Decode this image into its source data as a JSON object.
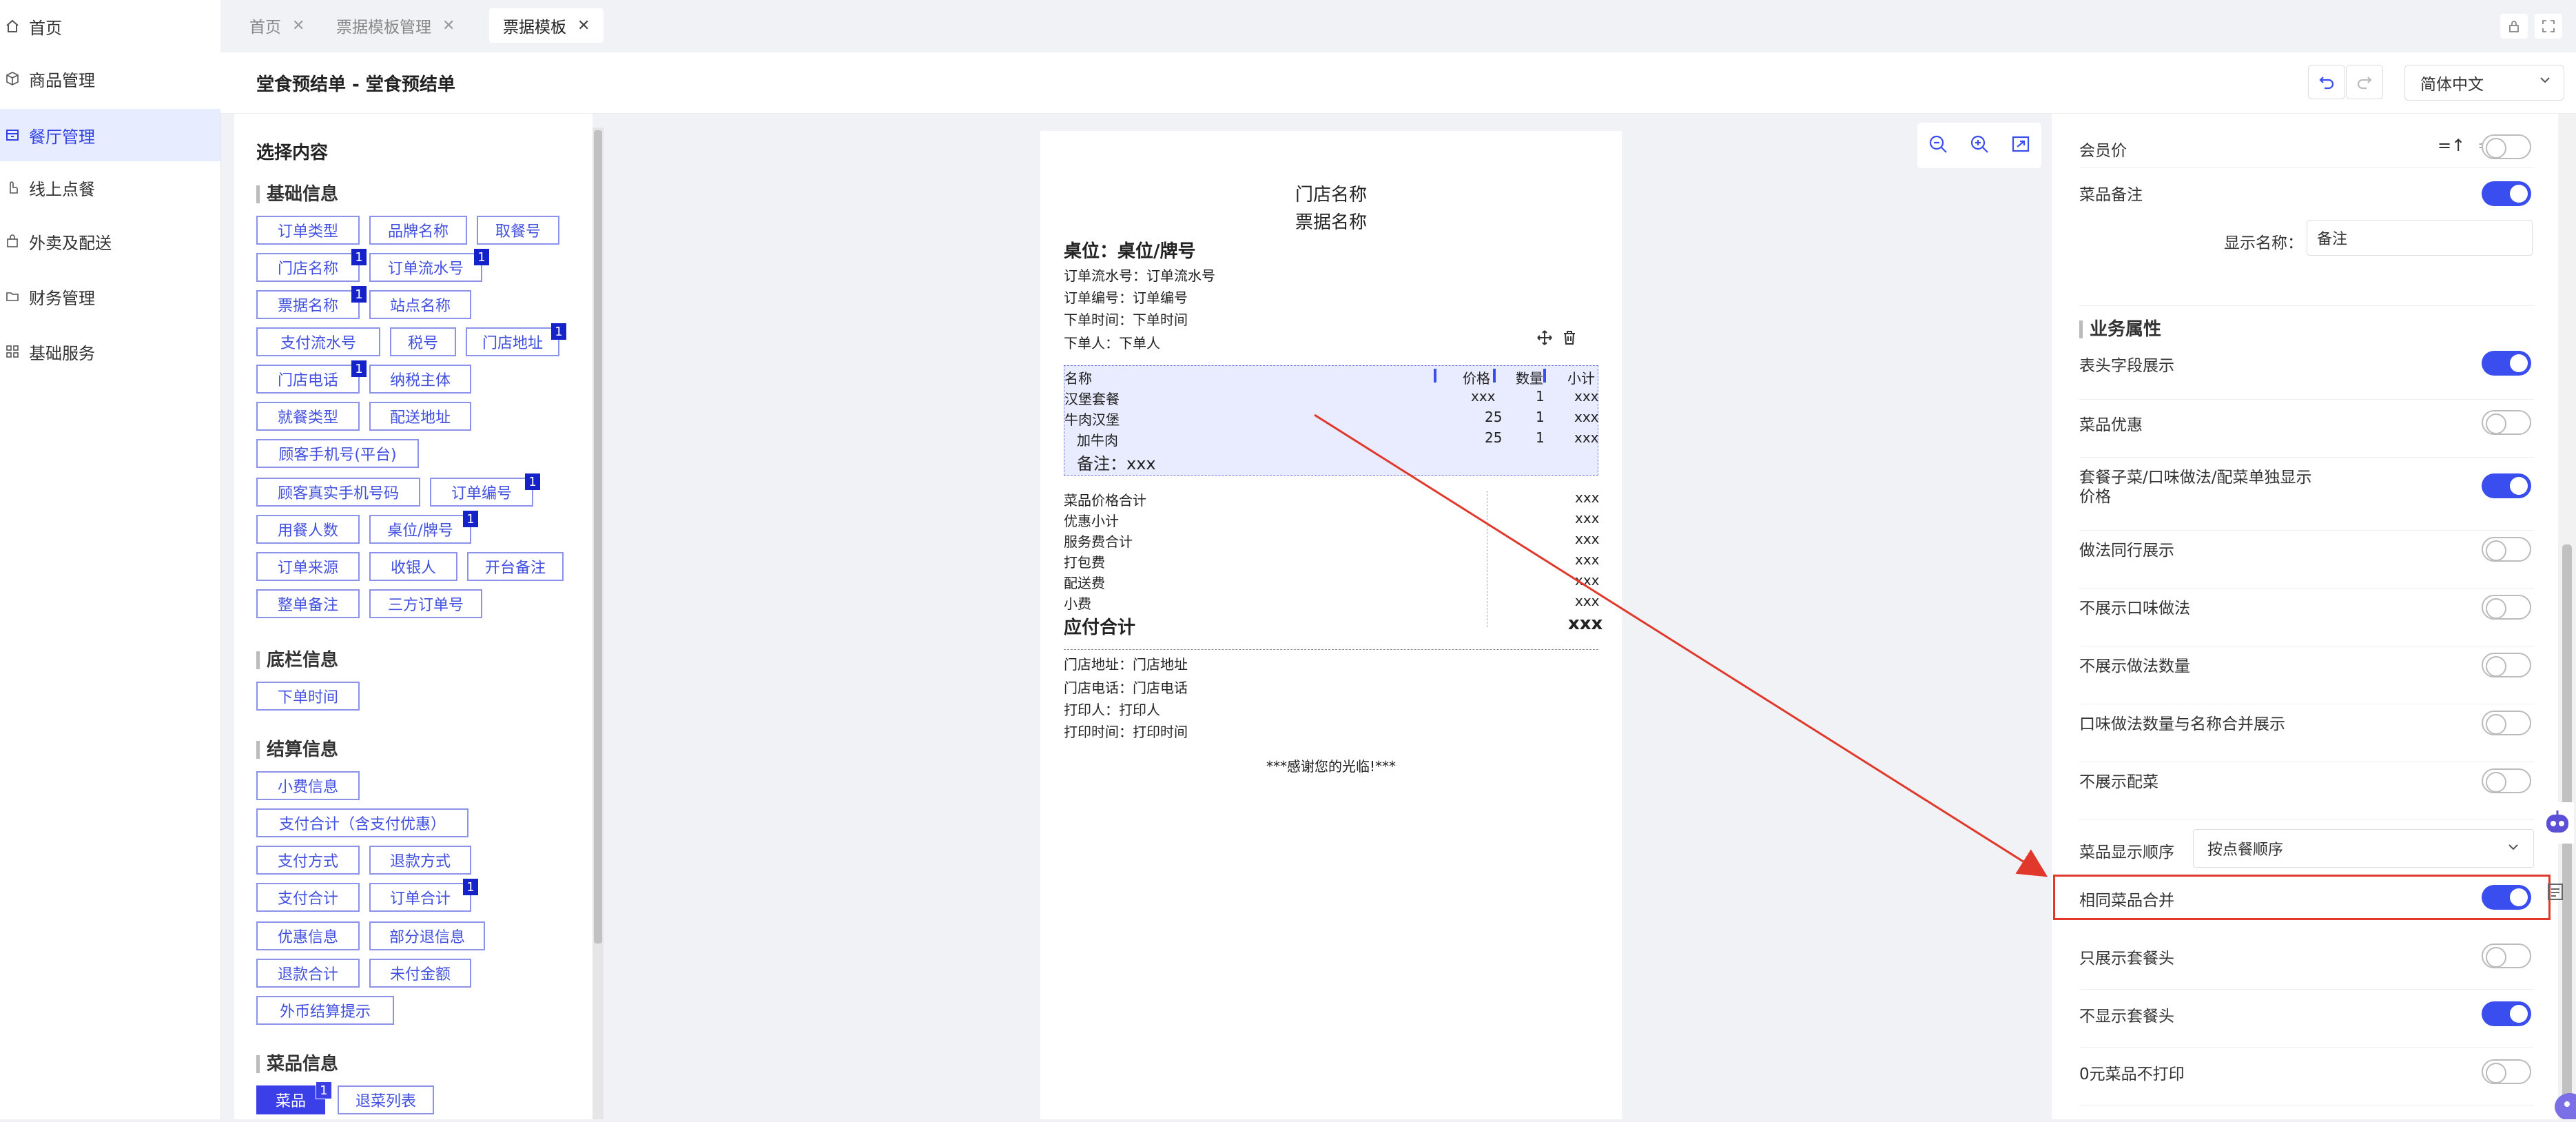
{
  "sidebar": {
    "items": [
      {
        "label": "首页",
        "icon": "home-icon"
      },
      {
        "label": "商品管理",
        "icon": "cube-icon"
      },
      {
        "label": "餐厅管理",
        "icon": "store-icon",
        "active": true
      },
      {
        "label": "线上点餐",
        "icon": "hand-icon"
      },
      {
        "label": "外卖及配送",
        "icon": "bag-icon"
      },
      {
        "label": "财务管理",
        "icon": "folder-icon"
      },
      {
        "label": "基础服务",
        "icon": "grid-icon"
      }
    ]
  },
  "tabs": [
    {
      "label": "首页"
    },
    {
      "label": "票据模板管理"
    },
    {
      "label": "票据模板",
      "active": true
    }
  ],
  "header": {
    "title": "堂食预结单 - 堂食预结单",
    "language": "简体中文"
  },
  "left_panel": {
    "title": "选择内容",
    "groups": {
      "basic": "基础信息",
      "footer": "底栏信息",
      "settlement": "结算信息",
      "dish": "菜品信息"
    },
    "badge": "1",
    "chips": {
      "order_type": "订单类型",
      "brand_name": "品牌名称",
      "pickup_no": "取餐号",
      "store_name": "门店名称",
      "order_serial": "订单流水号",
      "ticket_name": "票据名称",
      "site_name": "站点名称",
      "pay_serial": "支付流水号",
      "tax_no": "税号",
      "store_addr": "门店地址",
      "store_phone": "门店电话",
      "tax_entity": "纳税主体",
      "dine_type": "就餐类型",
      "delivery_addr": "配送地址",
      "customer_phone_platform": "顾客手机号(平台)",
      "customer_real_phone": "顾客真实手机号码",
      "order_no": "订单编号",
      "diners": "用餐人数",
      "table_no": "桌位/牌号",
      "order_source": "订单来源",
      "cashier": "收银人",
      "open_note": "开台备注",
      "order_note": "整单备注",
      "third_order_no": "三方订单号",
      "order_time": "下单时间",
      "tip_info": "小费信息",
      "pay_total_incl": "支付合计（含支付优惠）",
      "pay_method": "支付方式",
      "refund_method": "退款方式",
      "pay_total": "支付合计",
      "order_total": "订单合计",
      "discount_info": "优惠信息",
      "partial_refund": "部分退信息",
      "refund_total": "退款合计",
      "unpaid": "未付金额",
      "fx_hint": "外币结算提示",
      "dish": "菜品",
      "refund_list": "退菜列表"
    }
  },
  "receipt": {
    "store_name": "门店名称",
    "ticket_name": "票据名称",
    "table": "桌位：桌位/牌号",
    "serial": "订单流水号：订单流水号",
    "order_no": "订单编号：订单编号",
    "order_time": "下单时间：下单时间",
    "orderer": "下单人：下单人",
    "table_head": {
      "name": "名称",
      "price": "价格",
      "qty": "数量",
      "subtotal": "小计"
    },
    "items": [
      {
        "name": "汉堡套餐",
        "price": "xxx",
        "qty": "1",
        "subtotal": "xxx"
      },
      {
        "name": "牛肉汉堡",
        "price": "25",
        "qty": "1",
        "subtotal": "xxx"
      },
      {
        "name": "加牛肉",
        "price": "25",
        "qty": "1",
        "subtotal": "xxx"
      }
    ],
    "note": "备注：xxx",
    "summary": [
      {
        "label": "菜品价格合计",
        "value": "xxx"
      },
      {
        "label": "优惠小计",
        "value": "xxx"
      },
      {
        "label": "服务费合计",
        "value": "xxx"
      },
      {
        "label": "打包费",
        "value": "xxx"
      },
      {
        "label": "配送费",
        "value": "xxx"
      },
      {
        "label": "小费",
        "value": "xxx"
      }
    ],
    "total_label": "应付合计",
    "total_value": "xxx",
    "store_addr": "门店地址：门店地址",
    "store_phone": "门店电话：门店电话",
    "printer": "打印人：打印人",
    "print_time": "打印时间：打印时间",
    "thanks": "***感谢您的光临!***"
  },
  "right_panel": {
    "member_price": "会员价",
    "sort_asc": "=↑",
    "sort_desc": "=↓",
    "dish_note": "菜品备注",
    "display_name_label": "显示名称：",
    "display_name_value": "备注",
    "business_title": "业务属性",
    "toggles": [
      {
        "label": "表头字段展示",
        "on": true
      },
      {
        "label": "菜品优惠",
        "on": false
      },
      {
        "label": "套餐子菜/口味做法/配菜单独显示价格",
        "on": true
      },
      {
        "label": "做法同行展示",
        "on": false
      },
      {
        "label": "不展示口味做法",
        "on": false
      },
      {
        "label": "不展示做法数量",
        "on": false
      },
      {
        "label": "口味做法数量与名称合并展示",
        "on": false
      },
      {
        "label": "不展示配菜",
        "on": false
      }
    ],
    "order_label": "菜品显示顺序",
    "order_value": "按点餐顺序",
    "merge_label": "相同菜品合并",
    "after": [
      {
        "label": "只展示套餐头",
        "on": false
      },
      {
        "label": "不显示套餐头",
        "on": true
      },
      {
        "label": "0元菜品不打印",
        "on": false
      }
    ]
  },
  "colors": {
    "accent": "#3a4ef0",
    "annotation": "#e0392b"
  }
}
